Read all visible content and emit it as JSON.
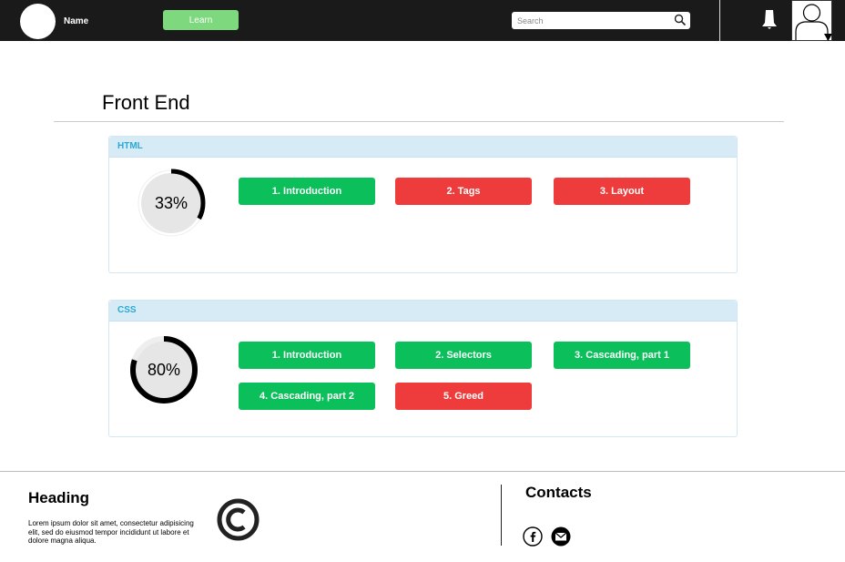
{
  "header": {
    "user_name": "Name",
    "learn_label": "Learn",
    "search_placeholder": "Search"
  },
  "page": {
    "title": "Front End"
  },
  "courses": [
    {
      "title": "HTML",
      "progress_label": "33%",
      "progress_percent": 33,
      "lessons": [
        {
          "label": "1.  Introduction",
          "status": "complete"
        },
        {
          "label": "2. Tags",
          "status": "incomplete"
        },
        {
          "label": "3. Layout",
          "status": "incomplete"
        }
      ]
    },
    {
      "title": "CSS",
      "progress_label": "80%",
      "progress_percent": 80,
      "lessons": [
        {
          "label": "1.  Introduction",
          "status": "complete"
        },
        {
          "label": "2. Selectors",
          "status": "complete"
        },
        {
          "label": "3. Cascading, part 1",
          "status": "complete"
        },
        {
          "label": "4. Cascading, part 2",
          "status": "complete"
        },
        {
          "label": "5. Greed",
          "status": "incomplete"
        }
      ]
    }
  ],
  "footer": {
    "heading": "Heading",
    "body": "Lorem ipsum dolor sit amet, consectetur adipisicing elit, sed do eiusmod tempor incididunt ut labore et dolore magna aliqua.",
    "contacts_heading": "Contacts",
    "social_icons": [
      "facebook-icon",
      "email-icon"
    ]
  },
  "colors": {
    "topbar": "#1a1a1a",
    "learn_button": "#7ed87e",
    "complete": "#0bbf5a",
    "incomplete": "#ee3c3c",
    "card_header": "#d7ebf7",
    "card_title": "#2aa9d2"
  }
}
